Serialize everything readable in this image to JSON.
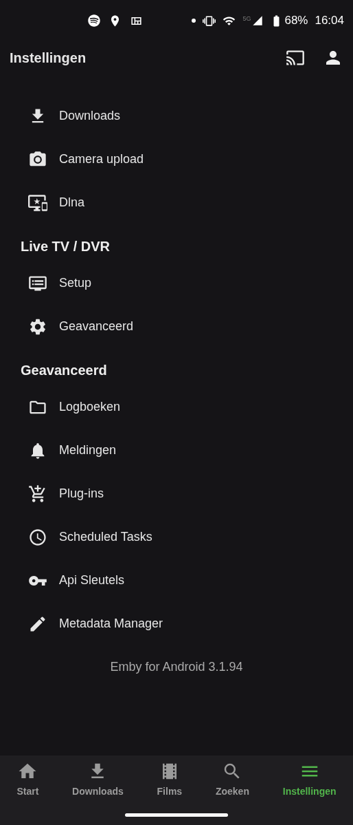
{
  "status_bar": {
    "five_g": "5G",
    "battery": "68%",
    "time": "16:04"
  },
  "app_bar": {
    "title": "Instellingen"
  },
  "sections": [
    {
      "items": [
        {
          "label": "Downloads"
        },
        {
          "label": "Camera upload"
        },
        {
          "label": "Dlna"
        }
      ]
    },
    {
      "header": "Live TV / DVR",
      "items": [
        {
          "label": "Setup"
        },
        {
          "label": "Geavanceerd"
        }
      ]
    },
    {
      "header": "Geavanceerd",
      "items": [
        {
          "label": "Logboeken"
        },
        {
          "label": "Meldingen"
        },
        {
          "label": "Plug-ins"
        },
        {
          "label": "Scheduled Tasks"
        },
        {
          "label": "Api Sleutels"
        },
        {
          "label": "Metadata Manager"
        }
      ]
    }
  ],
  "footer": "Emby for Android 3.1.94",
  "bottom_nav": [
    {
      "label": "Start",
      "selected": false
    },
    {
      "label": "Downloads",
      "selected": false
    },
    {
      "label": "Films",
      "selected": false
    },
    {
      "label": "Zoeken",
      "selected": false
    },
    {
      "label": "Instellingen",
      "selected": true
    }
  ]
}
